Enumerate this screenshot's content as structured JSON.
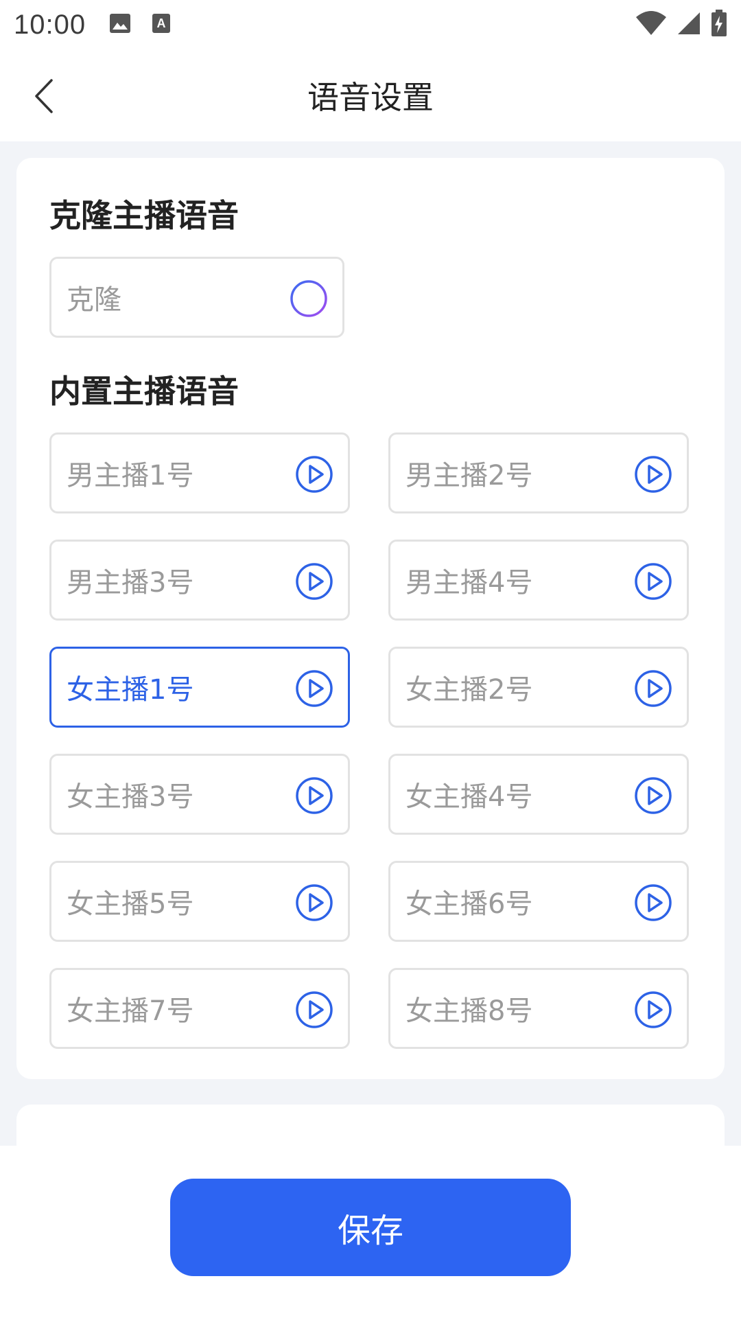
{
  "status_bar": {
    "time": "10:00",
    "left_icons": [
      "image-icon",
      "text-a-icon"
    ],
    "right_icons": [
      "wifi-icon",
      "signal-icon",
      "battery-charging-icon"
    ]
  },
  "app_bar": {
    "back_icon": "chevron-left-icon",
    "title": "语音设置"
  },
  "clone_section": {
    "title": "克隆主播语音",
    "clone_button_label": "克隆",
    "clone_icon": "plus-circle-icon"
  },
  "builtin_section": {
    "title": "内置主播语音",
    "play_icon": "play-circle-icon",
    "voices": [
      {
        "label": "男主播1号",
        "selected": false
      },
      {
        "label": "男主播2号",
        "selected": false
      },
      {
        "label": "男主播3号",
        "selected": false
      },
      {
        "label": "男主播4号",
        "selected": false
      },
      {
        "label": "女主播1号",
        "selected": true
      },
      {
        "label": "女主播2号",
        "selected": false
      },
      {
        "label": "女主播3号",
        "selected": false
      },
      {
        "label": "女主播4号",
        "selected": false
      },
      {
        "label": "女主播5号",
        "selected": false
      },
      {
        "label": "女主播6号",
        "selected": false
      },
      {
        "label": "女主播7号",
        "selected": false
      },
      {
        "label": "女主播8号",
        "selected": false
      }
    ]
  },
  "colors": {
    "accent": "#2d62e6",
    "save_button": "#2d64f2",
    "inactive_text": "#9a9a9a",
    "background": "#f2f4f8"
  },
  "bottom_bar": {
    "save_label": "保存"
  }
}
